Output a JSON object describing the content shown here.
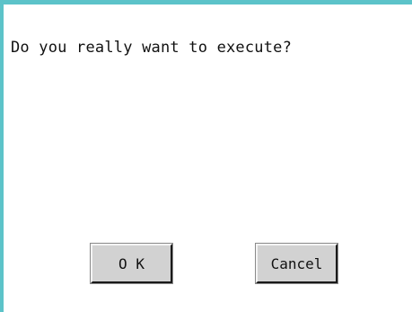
{
  "dialog": {
    "message": "Do you really want to execute?",
    "ok_label": "O K",
    "cancel_label": "Cancel"
  },
  "colors": {
    "frame_accent": "#5cc3c9",
    "button_face": "#d2d2d2",
    "background": "#ffffff"
  }
}
